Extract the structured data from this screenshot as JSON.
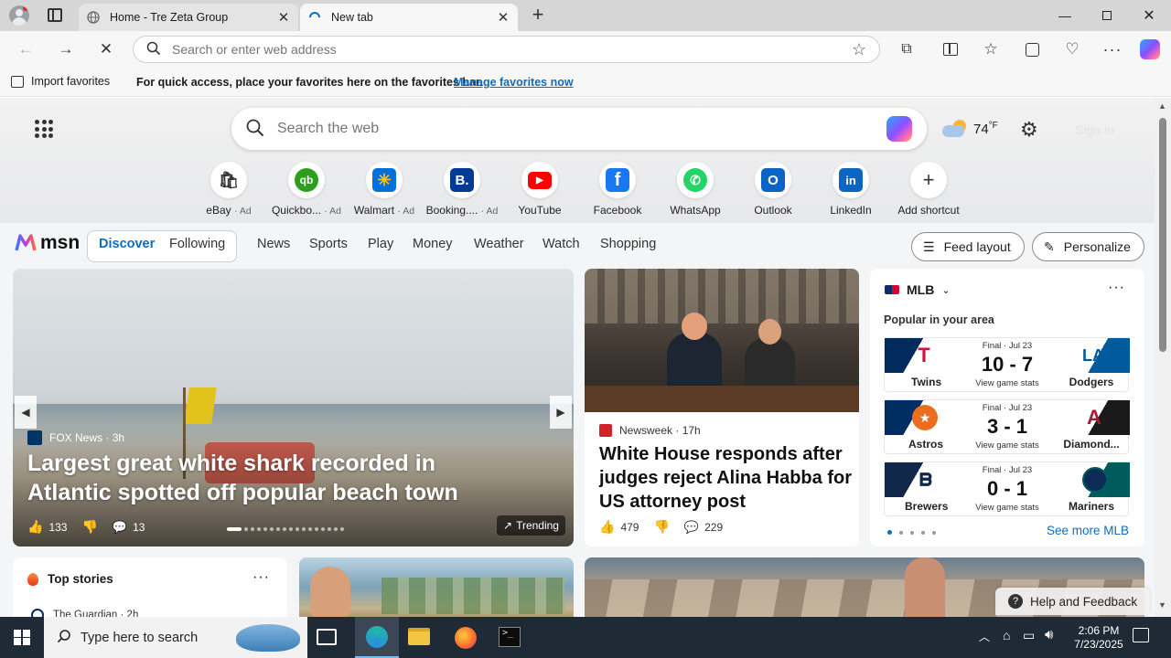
{
  "browser": {
    "tabs": [
      {
        "title": "Home - Tre Zeta Group"
      },
      {
        "title": "New tab"
      }
    ],
    "address": {
      "placeholder": "Search or enter web address"
    },
    "favorites_bar": {
      "import_label": "Import favorites",
      "message": "For quick access, place your favorites here on the favorites bar.",
      "manage_link": "Manage favorites now"
    }
  },
  "msn": {
    "search_placeholder": "Search the web",
    "weather": {
      "temp": "74",
      "unit": "°F"
    },
    "sign_in": "Sign in",
    "shortcuts": [
      {
        "label": "eBay",
        "ad": "· Ad",
        "icon": "ebay-icon"
      },
      {
        "label": "Quickbo...",
        "ad": "· Ad",
        "icon": "quickbooks-icon"
      },
      {
        "label": "Walmart",
        "ad": "· Ad",
        "icon": "walmart-icon"
      },
      {
        "label": "Booking....",
        "ad": "· Ad",
        "icon": "booking-icon"
      },
      {
        "label": "YouTube",
        "ad": "",
        "icon": "youtube-icon"
      },
      {
        "label": "Facebook",
        "ad": "",
        "icon": "facebook-icon"
      },
      {
        "label": "WhatsApp",
        "ad": "",
        "icon": "whatsapp-icon"
      },
      {
        "label": "Outlook",
        "ad": "",
        "icon": "outlook-icon"
      },
      {
        "label": "LinkedIn",
        "ad": "",
        "icon": "linkedin-icon"
      },
      {
        "label": "Add shortcut",
        "ad": "",
        "icon": "plus-icon"
      }
    ],
    "logo_text": "msn",
    "nav": {
      "discover": "Discover",
      "following": "Following",
      "items": [
        "News",
        "Sports",
        "Play",
        "Money",
        "Weather",
        "Watch",
        "Shopping"
      ],
      "feed_layout": "Feed layout",
      "personalize": "Personalize"
    },
    "hero": {
      "source": "FOX News",
      "time": "· 3h",
      "headline": "Largest great white shark recorded in Atlantic spotted off popular beach town",
      "likes": "133",
      "comments": "13",
      "badge": "Trending"
    },
    "story2": {
      "source": "Newsweek",
      "time": "· 17h",
      "headline": "White House responds after judges reject Alina Habba for US attorney post",
      "likes": "479",
      "comments": "229"
    },
    "mlb": {
      "title": "MLB",
      "subtitle": "Popular in your area",
      "games": [
        {
          "status": "Final · Jul 23",
          "score": "10 - 7",
          "home": "Twins",
          "away": "Dodgers",
          "stats": "View game stats"
        },
        {
          "status": "Final · Jul 23",
          "score": "3 - 1",
          "home": "Astros",
          "away": "Diamond...",
          "stats": "View game stats"
        },
        {
          "status": "Final · Jul 23",
          "score": "0 - 1",
          "home": "Brewers",
          "away": "Mariners",
          "stats": "View game stats"
        }
      ],
      "see_more": "See more MLB"
    },
    "top_stories": {
      "title": "Top stories",
      "source": "The Guardian",
      "time": "· 2h"
    },
    "help": "Help and Feedback"
  },
  "taskbar": {
    "search_placeholder": "Type here to search",
    "time": "2:06 PM",
    "date": "7/23/2025"
  },
  "colors": {
    "accent": "#0f6cbd",
    "taskbar": "#1f2a37"
  }
}
